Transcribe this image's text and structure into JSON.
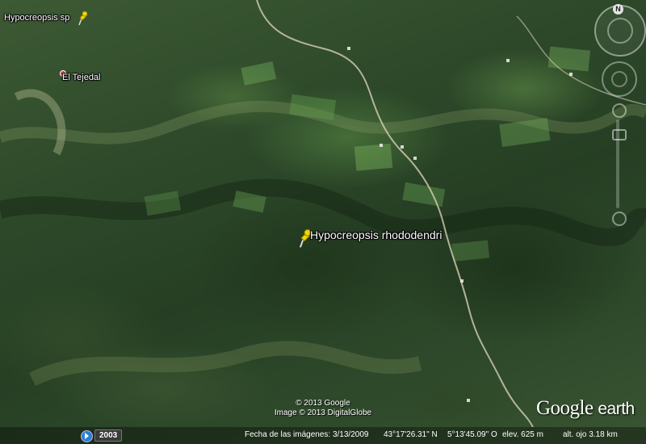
{
  "placemarks": [
    {
      "name": "Hypocreopsis sp",
      "pin": "yellow-pushpin-icon"
    },
    {
      "name": "El Tejedal",
      "pin": "red-dot-icon"
    },
    {
      "name": "Hypocreopsis rhododendri",
      "pin": "yellow-pushpin-icon"
    }
  ],
  "navigation": {
    "north_label": "N"
  },
  "copyright": {
    "line1": "© 2013 Google",
    "line2": "Image © 2013 DigitalGlobe"
  },
  "logo": {
    "brand": "Google",
    "product": "earth"
  },
  "status": {
    "history_year": "2003",
    "imagery_date": "Fecha de las imágenes: 3/13/2009",
    "latitude": "43°17'26.31\" N",
    "longitude": "5°13'45.09\" O",
    "elevation": "elev.  625 m",
    "eye_altitude": "alt. ojo   3.18 km"
  },
  "colors": {
    "pin_yellow": "#f2d600",
    "dot_red": "#e23d3d"
  }
}
